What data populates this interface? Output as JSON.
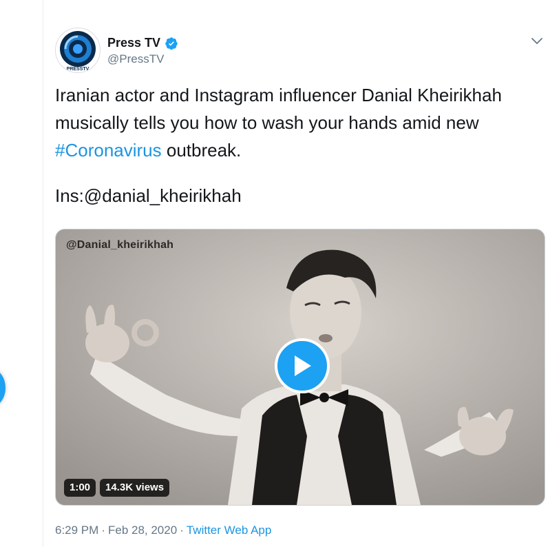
{
  "account": {
    "name": "Press TV",
    "handle": "@PressTV",
    "avatar_logo_text": "PRESSTV"
  },
  "tweet": {
    "text_before_hashtag": "Iranian actor and Instagram influencer Danial Kheirikhah musically tells you how to wash your hands amid new ",
    "hashtag": "#Coronavirus",
    "text_after_hashtag": " outbreak.",
    "mention_line": "Ins:@danial_kheirikhah"
  },
  "media": {
    "watermark": "@Danial_kheirikhah",
    "duration": "1:00",
    "views": "14.3K views"
  },
  "meta": {
    "time": "6:29 PM",
    "separator1": "·",
    "date": "Feb 28, 2020",
    "separator2": "·",
    "source": "Twitter Web App"
  },
  "colors": {
    "accent": "#1da1f2",
    "link": "#1b95e0",
    "secondary_text": "#657786"
  }
}
